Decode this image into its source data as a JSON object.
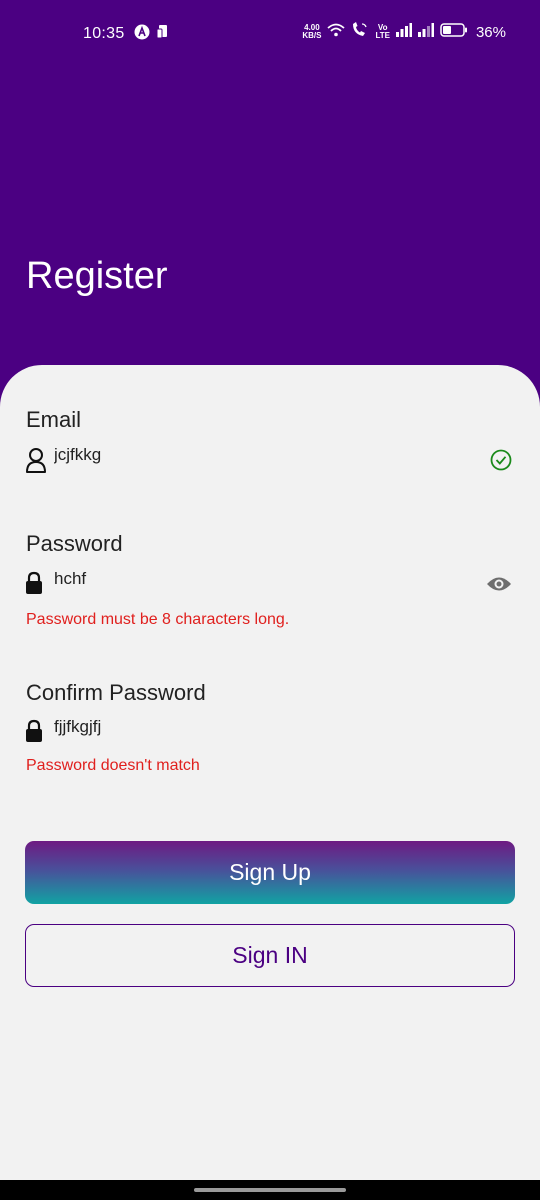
{
  "status_bar": {
    "time": "10:35",
    "net_speed_value": "4.00",
    "net_speed_unit": "KB/S",
    "volte_label_top": "Vo",
    "volte_label_bottom": "LTE",
    "battery_percent": "36%",
    "icons": [
      "a-icon",
      "phone-icon",
      "wifi-icon",
      "wifi-call-icon",
      "signal-icon",
      "signal-icon",
      "battery-icon"
    ]
  },
  "header": {
    "title": "Register"
  },
  "form": {
    "email": {
      "label": "Email",
      "value": "jcjfkkg",
      "icon": "person-icon",
      "status_icon": "check-circle-icon",
      "status_color": "#1a8a1a"
    },
    "password": {
      "label": "Password",
      "value": "hchf",
      "icon": "lock-icon",
      "toggle_icon": "eye-icon",
      "error": "Password must be 8 characters long."
    },
    "confirm_password": {
      "label": "Confirm Password",
      "value": "fjjfkgjfj",
      "icon": "lock-icon",
      "error": "Password doesn't match"
    }
  },
  "buttons": {
    "sign_up": "Sign Up",
    "sign_in": "Sign IN"
  },
  "colors": {
    "primary": "#4b0082",
    "error": "#e0201e",
    "card_bg": "#f2f2f2",
    "gradient_top": "#6e1a82",
    "gradient_bottom": "#11a3a3"
  }
}
